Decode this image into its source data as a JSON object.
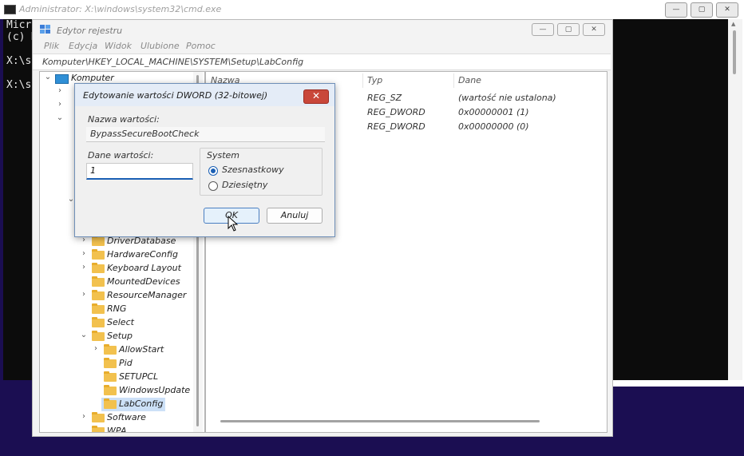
{
  "cmd": {
    "title": "Administrator: X:\\windows\\system32\\cmd.exe",
    "lines": [
      "Micro",
      "(c) M",
      "X:\\so",
      "X:\\so"
    ],
    "controls": {
      "minimize": "—",
      "maximize": "▢",
      "close": "✕"
    }
  },
  "regedit": {
    "title": "Edytor rejestru",
    "menu": [
      "Plik",
      "Edycja",
      "Widok",
      "Ulubione",
      "Pomoc"
    ],
    "address": "Komputer\\HKEY_LOCAL_MACHINE\\SYSTEM\\Setup\\LabConfig",
    "tree": {
      "root": "Komputer",
      "items": [
        "DriverDatabase",
        "HardwareConfig",
        "Keyboard Layout",
        "MountedDevices",
        "ResourceManager",
        "RNG",
        "Select",
        "Setup",
        "AllowStart",
        "Pid",
        "SETUPCL",
        "WindowsUpdate",
        "LabConfig",
        "Software",
        "WPA"
      ]
    },
    "list": {
      "headers": {
        "name": "Nazwa",
        "type": "Typ",
        "data": "Dane"
      },
      "rows": [
        {
          "type": "REG_SZ",
          "data": "(wartość nie ustalona)"
        },
        {
          "type": "REG_DWORD",
          "data": "0x00000001 (1)"
        },
        {
          "type": "REG_DWORD",
          "data": "0x00000000 (0)"
        }
      ]
    }
  },
  "dialog": {
    "title": "Edytowanie wartości DWORD (32-bitowej)",
    "close_label": "✕",
    "value_name_label": "Nazwa wartości:",
    "value_name": "BypassSecureBootCheck",
    "value_data_label": "Dane wartości:",
    "value_data": "1",
    "base_group_label": "System",
    "base_hex": "Szesnastkowy",
    "base_dec": "Dziesiętny",
    "ok_label": "OK",
    "cancel_label": "Anuluj"
  },
  "colors": {
    "accent": "#1a5fb4",
    "desktop": "#1b0e52",
    "close_red": "#c9473a",
    "folder": "#f2c14e"
  }
}
